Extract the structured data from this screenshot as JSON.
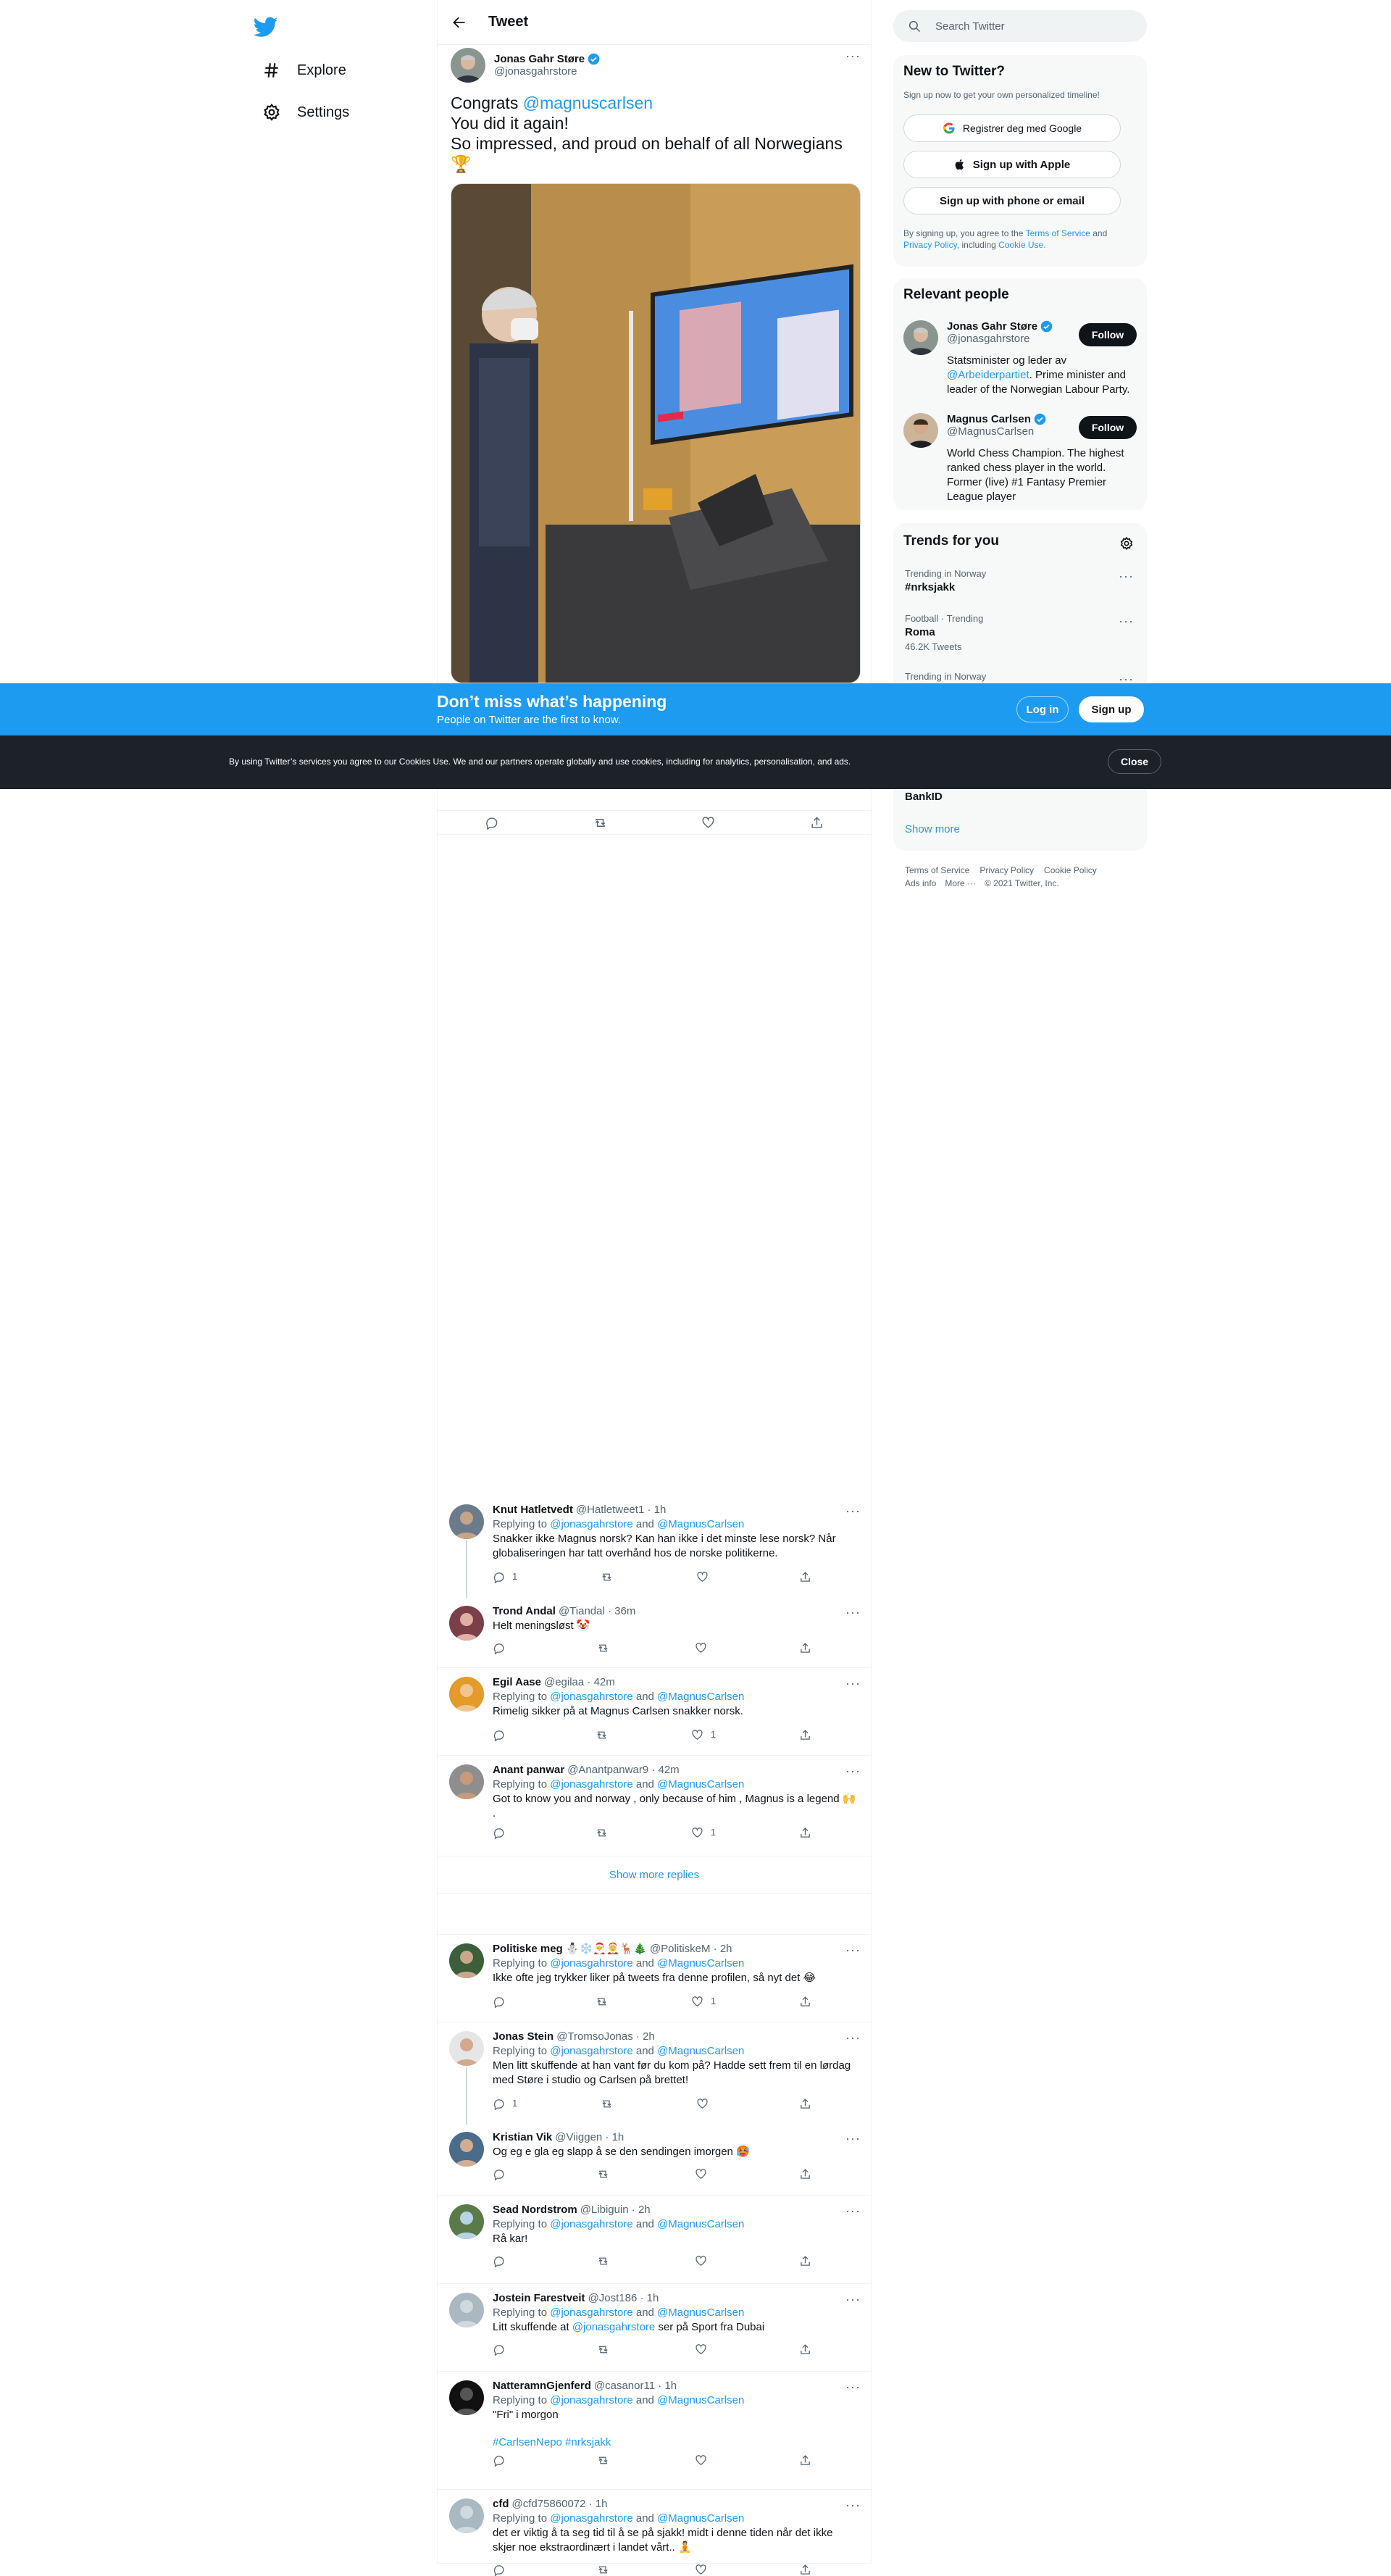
{
  "header": {
    "title": "Tweet"
  },
  "tweet": {
    "author_name": "Jonas Gahr Støre",
    "author_handle": "@jonasgahrstore",
    "text_prefix": "Congrats ",
    "mention": "@magnuscarlsen",
    "line2": "You did it again!",
    "line3": "So impressed, and proud on behalf of all Norwegians",
    "emoji": "🏆"
  },
  "nav": {
    "explore": "Explore",
    "settings": "Settings"
  },
  "search": {
    "placeholder": "Search Twitter"
  },
  "signup": {
    "title": "New to Twitter?",
    "subtitle": "Sign up now to get your own personalized timeline!",
    "google": "Registrer deg med Google",
    "apple": "Sign up with Apple",
    "phone": "Sign up with phone or email",
    "terms_1": "By signing up, you agree to the ",
    "terms_link1": "Terms of Service",
    "terms_2": " and ",
    "terms_link2": "Privacy Policy",
    "terms_3": ", including ",
    "terms_link3": "Cookie Use."
  },
  "relevant": {
    "title": "Relevant people",
    "people": [
      {
        "name": "Jonas Gahr Støre",
        "handle": "@jonasgahrstore",
        "bio_1": "Statsminister og leder av ",
        "bio_link": "@Arbeiderpartiet",
        "bio_2": ". Prime minister and leader of the Norwegian Labour Party.",
        "follow": "Follow"
      },
      {
        "name": "Magnus Carlsen",
        "handle": "@MagnusCarlsen",
        "bio": "World Chess Champion. The highest ranked chess player in the world. Former (live) #1 Fantasy Premier League player",
        "follow": "Follow"
      }
    ]
  },
  "trends": {
    "title": "Trends for you",
    "items": [
      {
        "meta": "Trending in Norway",
        "name": "#nrksjakk",
        "count": ""
      },
      {
        "meta": "Football · Trending",
        "name": "Roma",
        "count": "46.2K Tweets"
      },
      {
        "meta": "Trending in Norway",
        "name": "",
        "count": ""
      },
      {
        "meta": "",
        "name": "BankID",
        "count": ""
      }
    ],
    "show_more": "Show more"
  },
  "footer": {
    "links": [
      "Terms of Service",
      "Privacy Policy",
      "Cookie Policy"
    ],
    "links2": [
      "Ads info",
      "More ···",
      "© 2021 Twitter, Inc."
    ]
  },
  "banner": {
    "title": "Don’t miss what’s happening",
    "subtitle": "People on Twitter are the first to know.",
    "login": "Log in",
    "signup": "Sign up"
  },
  "cookie": {
    "text": "By using Twitter’s services you agree to our Cookies Use. We and our partners operate globally and use cookies, including for analytics, personalisation, and ads.",
    "close": "Close"
  },
  "replying_to": "Replying to",
  "and": "and",
  "show_more_replies": "Show more replies",
  "replies": [
    {
      "name": "Knut Hatletvedt",
      "handle": "@Hatletweet1 · 1h",
      "to1": "@jonasgahrstore",
      "to2": "@MagnusCarlsen",
      "text": "Snakker ikke Magnus norsk? Kan han ikke i det minste lese norsk? Når globaliseringen har tatt overhånd hos de norske politikerne.",
      "rc": "1",
      "lc": ""
    },
    {
      "name": "Trond Andal",
      "handle": "@Tiandal · 36m",
      "text": "Helt meningsløst 🤡",
      "rc": "",
      "lc": ""
    },
    {
      "name": "Egil Aase",
      "handle": "@egilaa · 42m",
      "to1": "@jonasgahrstore",
      "to2": "@MagnusCarlsen",
      "text": "Rimelig sikker på at Magnus Carlsen snakker norsk.",
      "rc": "",
      "lc": "1"
    },
    {
      "name": "Anant panwar",
      "handle": "@Anantpanwar9 · 42m",
      "to1": "@jonasgahrstore",
      "to2": "@MagnusCarlsen",
      "text": "Got to know  you and norway , only  because of him , Magnus is a legend 🙌",
      "text2": ".",
      "rc": "",
      "lc": "1"
    },
    {
      "name": "Politiske meg ⛄❄️🎅🤶🦌🎄",
      "handle": "@PolitiskeM · 2h",
      "to1": "@jonasgahrstore",
      "to2": "@MagnusCarlsen",
      "text": "Ikke ofte jeg trykker liker på tweets fra denne profilen, så nyt det 😂",
      "rc": "",
      "lc": "1"
    },
    {
      "name": "Jonas Stein",
      "handle": "@TromsoJonas · 2h",
      "to1": "@jonasgahrstore",
      "to2": "@MagnusCarlsen",
      "text": "Men litt skuffende at han vant før du kom på? Hadde sett frem til en lørdag med Støre i studio og Carlsen på brettet!",
      "rc": "1",
      "lc": ""
    },
    {
      "name": "Kristian Vik",
      "handle": "@Viiggen · 1h",
      "text": "Og eg e gla eg slapp å se den sendingen imorgen 🥵",
      "rc": "",
      "lc": ""
    },
    {
      "name": "Sead Nordstrom",
      "handle": "@Libiguin · 2h",
      "to1": "@jonasgahrstore",
      "to2": "@MagnusCarlsen",
      "text": "Rå kar!",
      "rc": "",
      "lc": ""
    },
    {
      "name": "Jostein Farestveit",
      "handle": "@Jost186 · 1h",
      "to1": "@jonasgahrstore",
      "to2": "@MagnusCarlsen",
      "text_a": "Litt skuffende at ",
      "text_link": "@jonasgahrstore",
      "text_b": " ser på Sport fra Dubai",
      "rc": "",
      "lc": ""
    },
    {
      "name": "NatteramnGjenferd",
      "handle": "@casanor11 · 1h",
      "to1": "@jonasgahrstore",
      "to2": "@MagnusCarlsen",
      "text": "\"Fri\" i morgon",
      "tags": "#CarlsenNepo #nrksjakk",
      "rc": "",
      "lc": ""
    },
    {
      "name": "cfd",
      "handle": "@cfd75860072 · 1h",
      "to1": "@jonasgahrstore",
      "to2": "@MagnusCarlsen",
      "text": "det er viktig å ta seg tid til å se på sjakk! midt i denne tiden når det ikke skjer noe ekstraordinært i landet vårt.. 🧘",
      "rc": "",
      "lc": ""
    }
  ]
}
